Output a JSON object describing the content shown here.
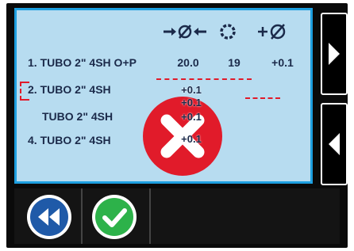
{
  "header": {
    "col1_icon": "arrows-diameter-icon",
    "col2_icon": "ring-icon",
    "col3_icon": "plus-diameter-icon"
  },
  "rows": [
    {
      "label": "1. TUBO 2\" 4SH O+P",
      "v1": "20.0",
      "v2": "19",
      "v3": "+0.1"
    },
    {
      "label": "2. TUBO 2\" 4SH",
      "v1": "",
      "v2": "",
      "v3": "+0.1"
    },
    {
      "label": "TUBO 2\" 4SH",
      "v1": "",
      "v2": "",
      "v3": "+0.1"
    },
    {
      "label": "4. TUBO 2\" 4SH",
      "v1": "",
      "v2": "",
      "v3": "+0.1"
    }
  ],
  "overlay_values": [
    "+0.1",
    "+0.1",
    "+0.1",
    "+0.1"
  ],
  "controls": {
    "next_icon": "chevron-right-icon",
    "prev_icon": "chevron-left-icon",
    "rewind_icon": "rewind-icon",
    "confirm_icon": "check-icon",
    "error_icon": "error-x-icon"
  },
  "colors": {
    "screen_bg": "#b7dcf0",
    "screen_border": "#1d9fe0",
    "error_red": "#e11b2a",
    "rewind_blue": "#1f5aa8",
    "confirm_green": "#2db24a"
  }
}
